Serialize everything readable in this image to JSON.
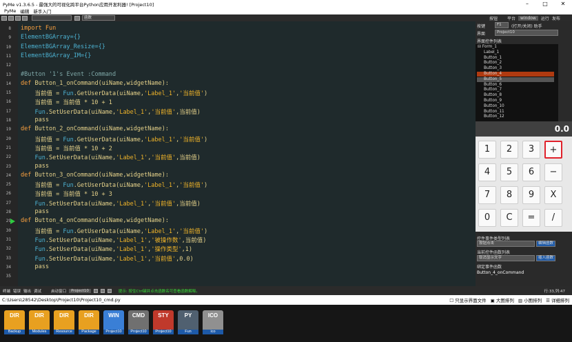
{
  "app": {
    "title": "PyMe v1.3.6.5 - 最强大的可视化跨平台Python应用开发利器! [Project10]",
    "menu": [
      "PyMe",
      "编辑",
      "新手入门"
    ]
  },
  "toolbar": {
    "func_select": "函数"
  },
  "right_top": {
    "items": [
      "按钮",
      "平台",
      "window",
      "运行",
      "发布"
    ]
  },
  "editor": {
    "lines": [
      {
        "n": "8",
        "html": "<span class='kw'>import</span> <span class='kw'>Fun</span>"
      },
      {
        "n": "9",
        "html": "<span class='pl'>ElementBGArray={}</span>"
      },
      {
        "n": "10",
        "html": "<span class='pl'>ElementBGArray_Resize={}</span>"
      },
      {
        "n": "11",
        "html": "<span class='pl'>ElementBGArray_IM={}</span>"
      },
      {
        "n": "12",
        "html": ""
      },
      {
        "n": "13",
        "html": "<span class='cm'>#Button '1's Event :Command</span>"
      },
      {
        "n": "14",
        "html": "<span class='kw'>def</span> <span class='tx'>Button_1_onCommand(uiName,widgetName):</span>"
      },
      {
        "n": "15",
        "html": "    <span class='tx'>当前值 = </span><span class='pl'>Fun</span><span class='tx'>.GetUserData(uiName,</span><span class='st'>'Label_1'</span><span class='tx'>,</span><span class='st'>'当前值'</span><span class='tx'>)</span>"
      },
      {
        "n": "16",
        "html": "    <span class='tx'>当前值 = 当前值 * 10 + 1</span>"
      },
      {
        "n": "17",
        "html": "    <span class='pl'>Fun</span><span class='tx'>.SetUserData(uiName,</span><span class='st'>'Label_1'</span><span class='tx'>,</span><span class='st'>'当前值'</span><span class='tx'>,当前值)</span>"
      },
      {
        "n": "18",
        "html": "    <span class='tx'>pass</span>"
      },
      {
        "n": "19",
        "html": "<span class='kw'>def</span> <span class='tx'>Button_2_onCommand(uiName,widgetName):</span>"
      },
      {
        "n": "20",
        "html": "    <span class='tx'>当前值 = </span><span class='pl'>Fun</span><span class='tx'>.GetUserData(uiName,</span><span class='st'>'Label_1'</span><span class='tx'>,</span><span class='st'>'当前值'</span><span class='tx'>)</span>"
      },
      {
        "n": "21",
        "html": "    <span class='tx'>当前值 = 当前值 * 10 + 2</span>"
      },
      {
        "n": "22",
        "html": "    <span class='pl'>Fun</span><span class='tx'>.SetUserData(uiName,</span><span class='st'>'Label_1'</span><span class='tx'>,</span><span class='st'>'当前值'</span><span class='tx'>,当前值)</span>"
      },
      {
        "n": "23",
        "html": "    <span class='tx'>pass</span>"
      },
      {
        "n": "24",
        "html": "<span class='kw'>def</span> <span class='tx'>Button_3_onCommand(uiName,widgetName):</span>"
      },
      {
        "n": "25",
        "html": "    <span class='tx'>当前值 = </span><span class='pl'>Fun</span><span class='tx'>.GetUserData(uiName,</span><span class='st'>'Label_1'</span><span class='tx'>,</span><span class='st'>'当前值'</span><span class='tx'>)</span>"
      },
      {
        "n": "26",
        "html": "    <span class='tx'>当前值 = 当前值 * 10 + 3</span>"
      },
      {
        "n": "27",
        "html": "    <span class='pl'>Fun</span><span class='tx'>.SetUserData(uiName,</span><span class='st'>'Label_1'</span><span class='tx'>,</span><span class='st'>'当前值'</span><span class='tx'>,当前值)</span>"
      },
      {
        "n": "28",
        "html": "    <span class='tx'>pass</span>"
      },
      {
        "n": "29",
        "html": "<span class='kw'>def</span> <span class='tx'>Button_4_onCommand(uiName,widgetName):</span>"
      },
      {
        "n": "30",
        "html": "    <span class='tx'>当前值 = </span><span class='pl'>Fun</span><span class='tx'>.GetUserData(uiName,</span><span class='st'>'Label_1'</span><span class='tx'>,</span><span class='st'>'当前值'</span><span class='tx'>)</span>"
      },
      {
        "n": "31",
        "html": "    <span class='pl'>Fun</span><span class='tx'>.SetUserData(uiName,</span><span class='st'>'Label_1'</span><span class='tx'>,</span><span class='st'>'被操作数'</span><span class='tx'>,当前值)</span>"
      },
      {
        "n": "32",
        "html": "    <span class='pl'>Fun</span><span class='tx'>.SetUserData(uiName,</span><span class='st'>'Label_1'</span><span class='tx'>,</span><span class='st'>'操作类型'</span><span class='tx'>,1)</span>"
      },
      {
        "n": "33",
        "html": "    <span class='pl'>Fun</span><span class='tx'>.SetUserData(uiName,</span><span class='st'>'Label_1'</span><span class='tx'>,</span><span class='st'>'当前值'</span><span class='tx'>,0.0)</span>"
      },
      {
        "n": "34",
        "html": "    <span class='tx'>pass</span>"
      },
      {
        "n": "35",
        "html": ""
      }
    ]
  },
  "right_panel": {
    "hotkey_label": "按键",
    "hotkey_value": "F1",
    "hotkey_hint": "(打开/关闭) 助手",
    "ui_label": "界面",
    "ui_value": "Project10",
    "list_title": "界面控件列表",
    "tree": [
      "Form_1",
      "Label_1",
      "Button_1",
      "Button_2",
      "Button_3",
      "Button_4",
      "Button_5",
      "Button_6",
      "Button_7",
      "Button_8",
      "Button_9",
      "Button_10",
      "Button_11",
      "Button_12"
    ],
    "event_type_title": "控件事件类型列表",
    "event_type_value": "按钮点击",
    "bind_btn": "编辑函数",
    "cur_func_title": "当前控件函数列表",
    "cur_func_value": "取消显示文字",
    "insert_btn": "插入函数",
    "bound_title": "绑定事件函数",
    "bound_value": "Button_4_onCommand"
  },
  "calculator": {
    "display": "0.0",
    "rows": [
      [
        "1",
        "2",
        "3",
        "+"
      ],
      [
        "4",
        "5",
        "6",
        "−"
      ],
      [
        "7",
        "8",
        "9",
        "X"
      ],
      [
        "0",
        "C",
        "=",
        "/"
      ]
    ]
  },
  "status": {
    "tabs": [
      "终端",
      "错误",
      "输出",
      "调试"
    ],
    "start_label": "启动窗口",
    "start_value": "Project10",
    "hint": "提示: 按住Ctrl键并点击函数名可查看函数解释。",
    "position": "行:33,列:47"
  },
  "path": {
    "text": "C:\\Users\\28542\\Desktop\\Project10\\Project10_cmd.py",
    "options": [
      "只显示界面文件",
      "大图排列",
      "小图排列",
      "详细排列"
    ]
  },
  "dock": [
    {
      "top": "DIR",
      "label": "Backup",
      "color": "#e8a020"
    },
    {
      "top": "DIR",
      "label": "Modules",
      "color": "#e8a020"
    },
    {
      "top": "DIR",
      "label": "Resource",
      "color": "#e8a020"
    },
    {
      "top": "DIR",
      "label": "Package",
      "color": "#e8a020"
    },
    {
      "top": "WIN",
      "label": "Project10",
      "color": "#3a7fd6"
    },
    {
      "top": "CMD",
      "label": "Project10",
      "color": "#707070"
    },
    {
      "top": "STY",
      "label": "Project10",
      "color": "#c0392b"
    },
    {
      "top": "PY",
      "label": "Fun",
      "color": "#506070"
    },
    {
      "top": "ICO",
      "label": "ico",
      "color": "#909090"
    }
  ]
}
